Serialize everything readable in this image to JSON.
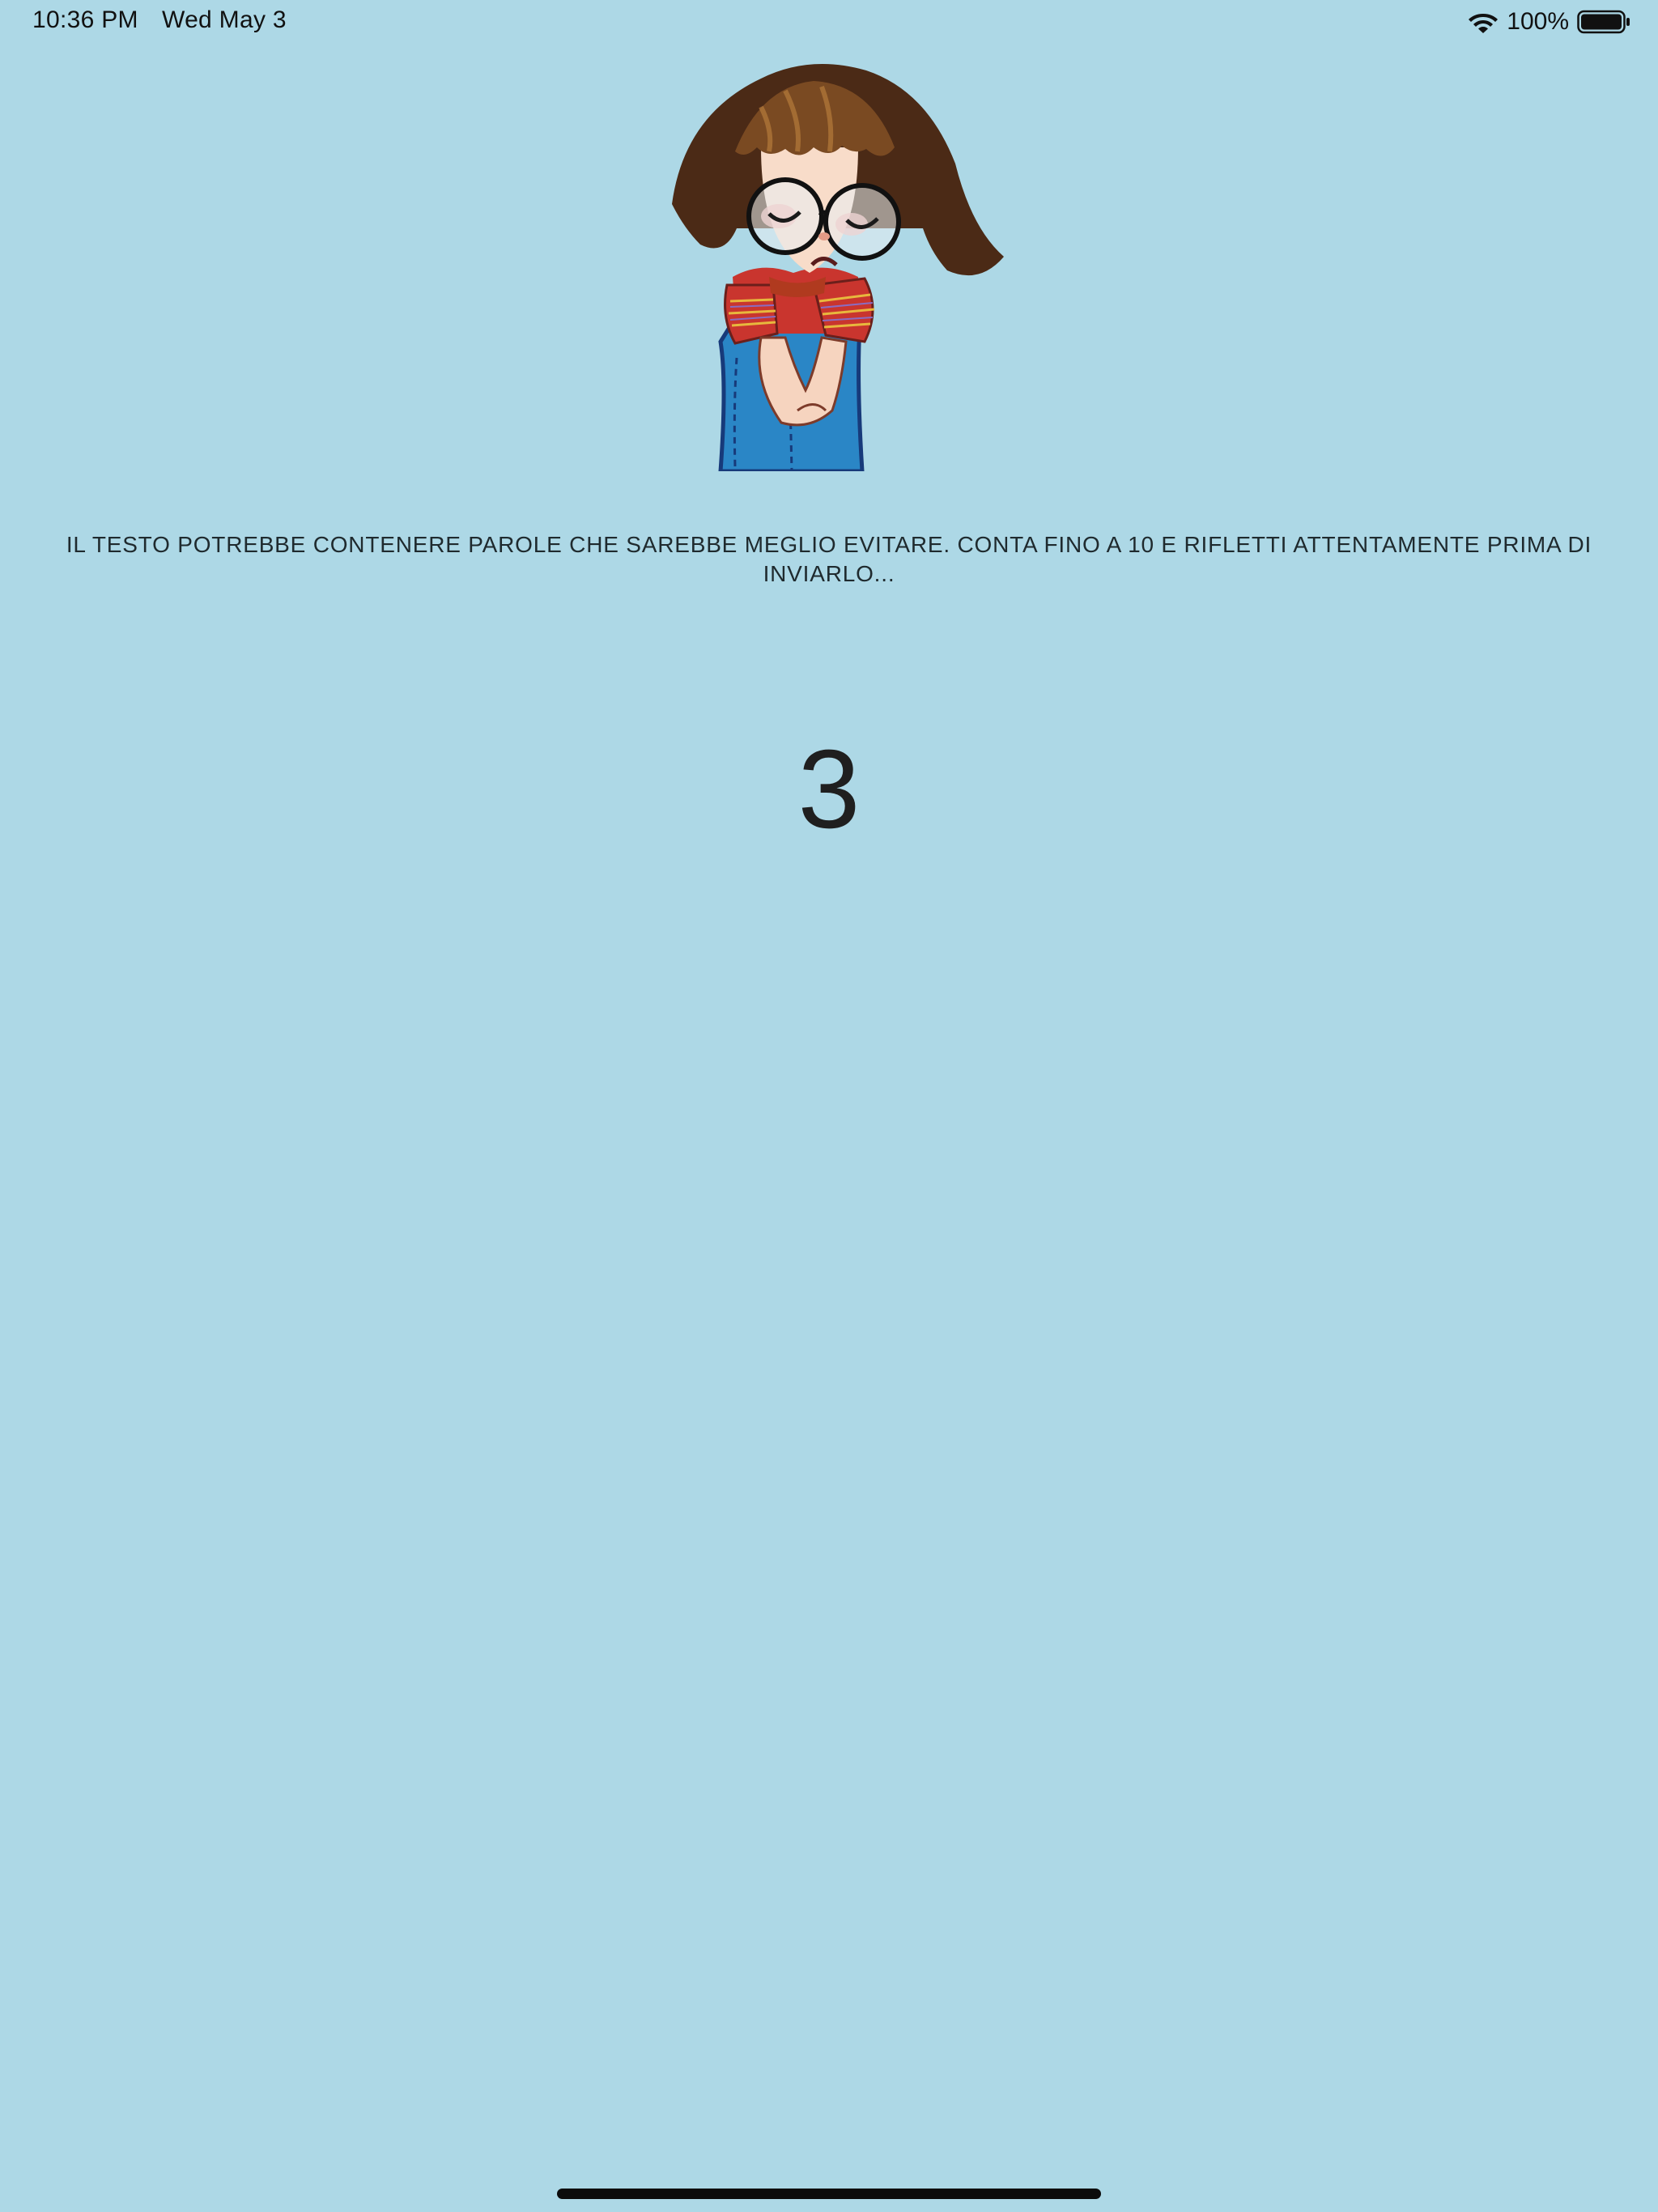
{
  "status_bar": {
    "time": "10:36 PM",
    "date": "Wed May 3",
    "battery_percent": "100%",
    "battery_level": 1.0,
    "wifi_icon": "wifi-icon",
    "battery_icon": "battery-icon"
  },
  "content": {
    "illustration": "sad-girl-illustration",
    "warning": "IL TESTO POTREBBE CONTENERE PAROLE CHE SAREBBE MEGLIO EVITARE. CONTA FINO A 10 E RIFLETTI ATTENTAMENTE PRIMA DI INVIARLO...",
    "countdown": "3"
  },
  "colors": {
    "background": "#add8e6",
    "text": "#1f2a2e",
    "home_indicator": "#0c0c0c"
  }
}
